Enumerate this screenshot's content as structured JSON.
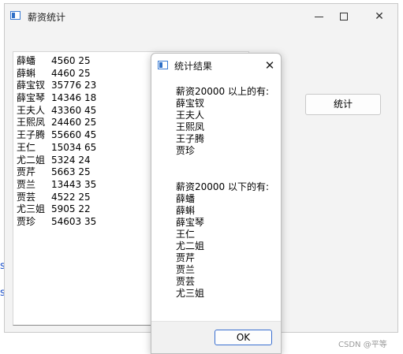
{
  "main_window": {
    "title": "薪资统计",
    "stats_button_label": "统计"
  },
  "employees_text": [
    {
      "name": "薛蟠",
      "rest": "4560 25"
    },
    {
      "name": "薛蝌",
      "rest": "4460 25"
    },
    {
      "name": "薛宝钗",
      "rest": "35776 23"
    },
    {
      "name": "薛宝琴",
      "rest": "14346 18"
    },
    {
      "name": "王夫人",
      "rest": "43360 45"
    },
    {
      "name": "王熙凤",
      "rest": "24460 25"
    },
    {
      "name": "王子腾",
      "rest": "55660 45"
    },
    {
      "name": "王仁",
      "rest": "15034 65"
    },
    {
      "name": "尤二姐",
      "rest": "5324 24"
    },
    {
      "name": "贾芹",
      "rest": "5663 25"
    },
    {
      "name": "贾兰",
      "rest": "13443 35"
    },
    {
      "name": "贾芸",
      "rest": "4522 25"
    },
    {
      "name": "尤三姐",
      "rest": "5905 22"
    },
    {
      "name": "贾珍",
      "rest": "54603 35"
    }
  ],
  "dialog": {
    "title": "统计结果",
    "above_header": "薪资20000 以上的有:",
    "above_list": [
      "薛宝钗",
      "王夫人",
      "王熙凤",
      "王子腾",
      "贾珍"
    ],
    "below_header": "薪资20000 以下的有:",
    "below_list": [
      "薛蟠",
      "薛蝌",
      "薛宝琴",
      "王仁",
      "尤二姐",
      "贾芹",
      "贾兰",
      "贾芸",
      "尤三姐"
    ],
    "ok_label": "OK"
  },
  "watermark": "CSDN @平等",
  "icons": {
    "app_icon": "window-icon",
    "close": "close-icon",
    "minimize": "minimize-icon",
    "maximize": "maximize-icon"
  },
  "colors": {
    "accent": "#3a6fd0",
    "window_bg": "#f3f3f3"
  }
}
